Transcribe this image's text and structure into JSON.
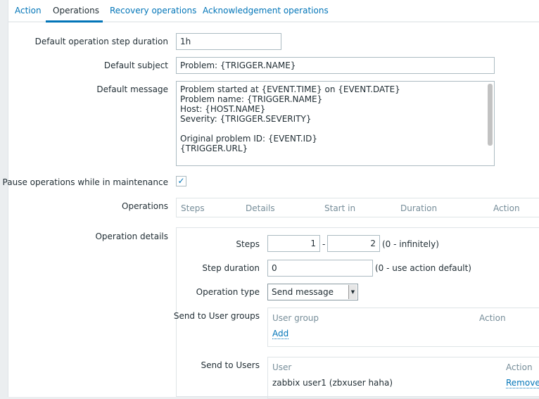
{
  "tabs": [
    {
      "label": "Action"
    },
    {
      "label": "Operations"
    },
    {
      "label": "Recovery operations"
    },
    {
      "label": "Acknowledgement operations"
    }
  ],
  "form": {
    "step_duration_label": "Default operation step duration",
    "step_duration_value": "1h",
    "subject_label": "Default subject",
    "subject_value": "Problem: {TRIGGER.NAME}",
    "message_label": "Default message",
    "message_value": "Problem started at {EVENT.TIME} on {EVENT.DATE}\nProblem name: {TRIGGER.NAME}\nHost: {HOST.NAME}\nSeverity: {TRIGGER.SEVERITY}\n\nOriginal problem ID: {EVENT.ID}\n{TRIGGER.URL}",
    "pause_label": "Pause operations while in maintenance",
    "pause_checked": true,
    "check_glyph": "✓",
    "operations_label": "Operations",
    "operations_columns": [
      "Steps",
      "Details",
      "Start in",
      "Duration",
      "Action"
    ]
  },
  "details": {
    "label": "Operation details",
    "steps_label": "Steps",
    "steps_from": "1",
    "steps_sep": "-",
    "steps_to": "2",
    "steps_note": "(0 - infinitely)",
    "step_duration_label": "Step duration",
    "step_duration_value": "0",
    "step_duration_note": "(0 - use action default)",
    "operation_type_label": "Operation type",
    "operation_type_value": "Send message",
    "user_groups_label": "Send to User groups",
    "user_groups_col1": "User group",
    "user_groups_col2": "Action",
    "add_label": "Add",
    "users_label": "Send to Users",
    "users_col1": "User",
    "users_col2": "Action",
    "users": [
      {
        "name": "zabbix user1 (zbxuser haha)",
        "action": "Remove"
      }
    ]
  }
}
